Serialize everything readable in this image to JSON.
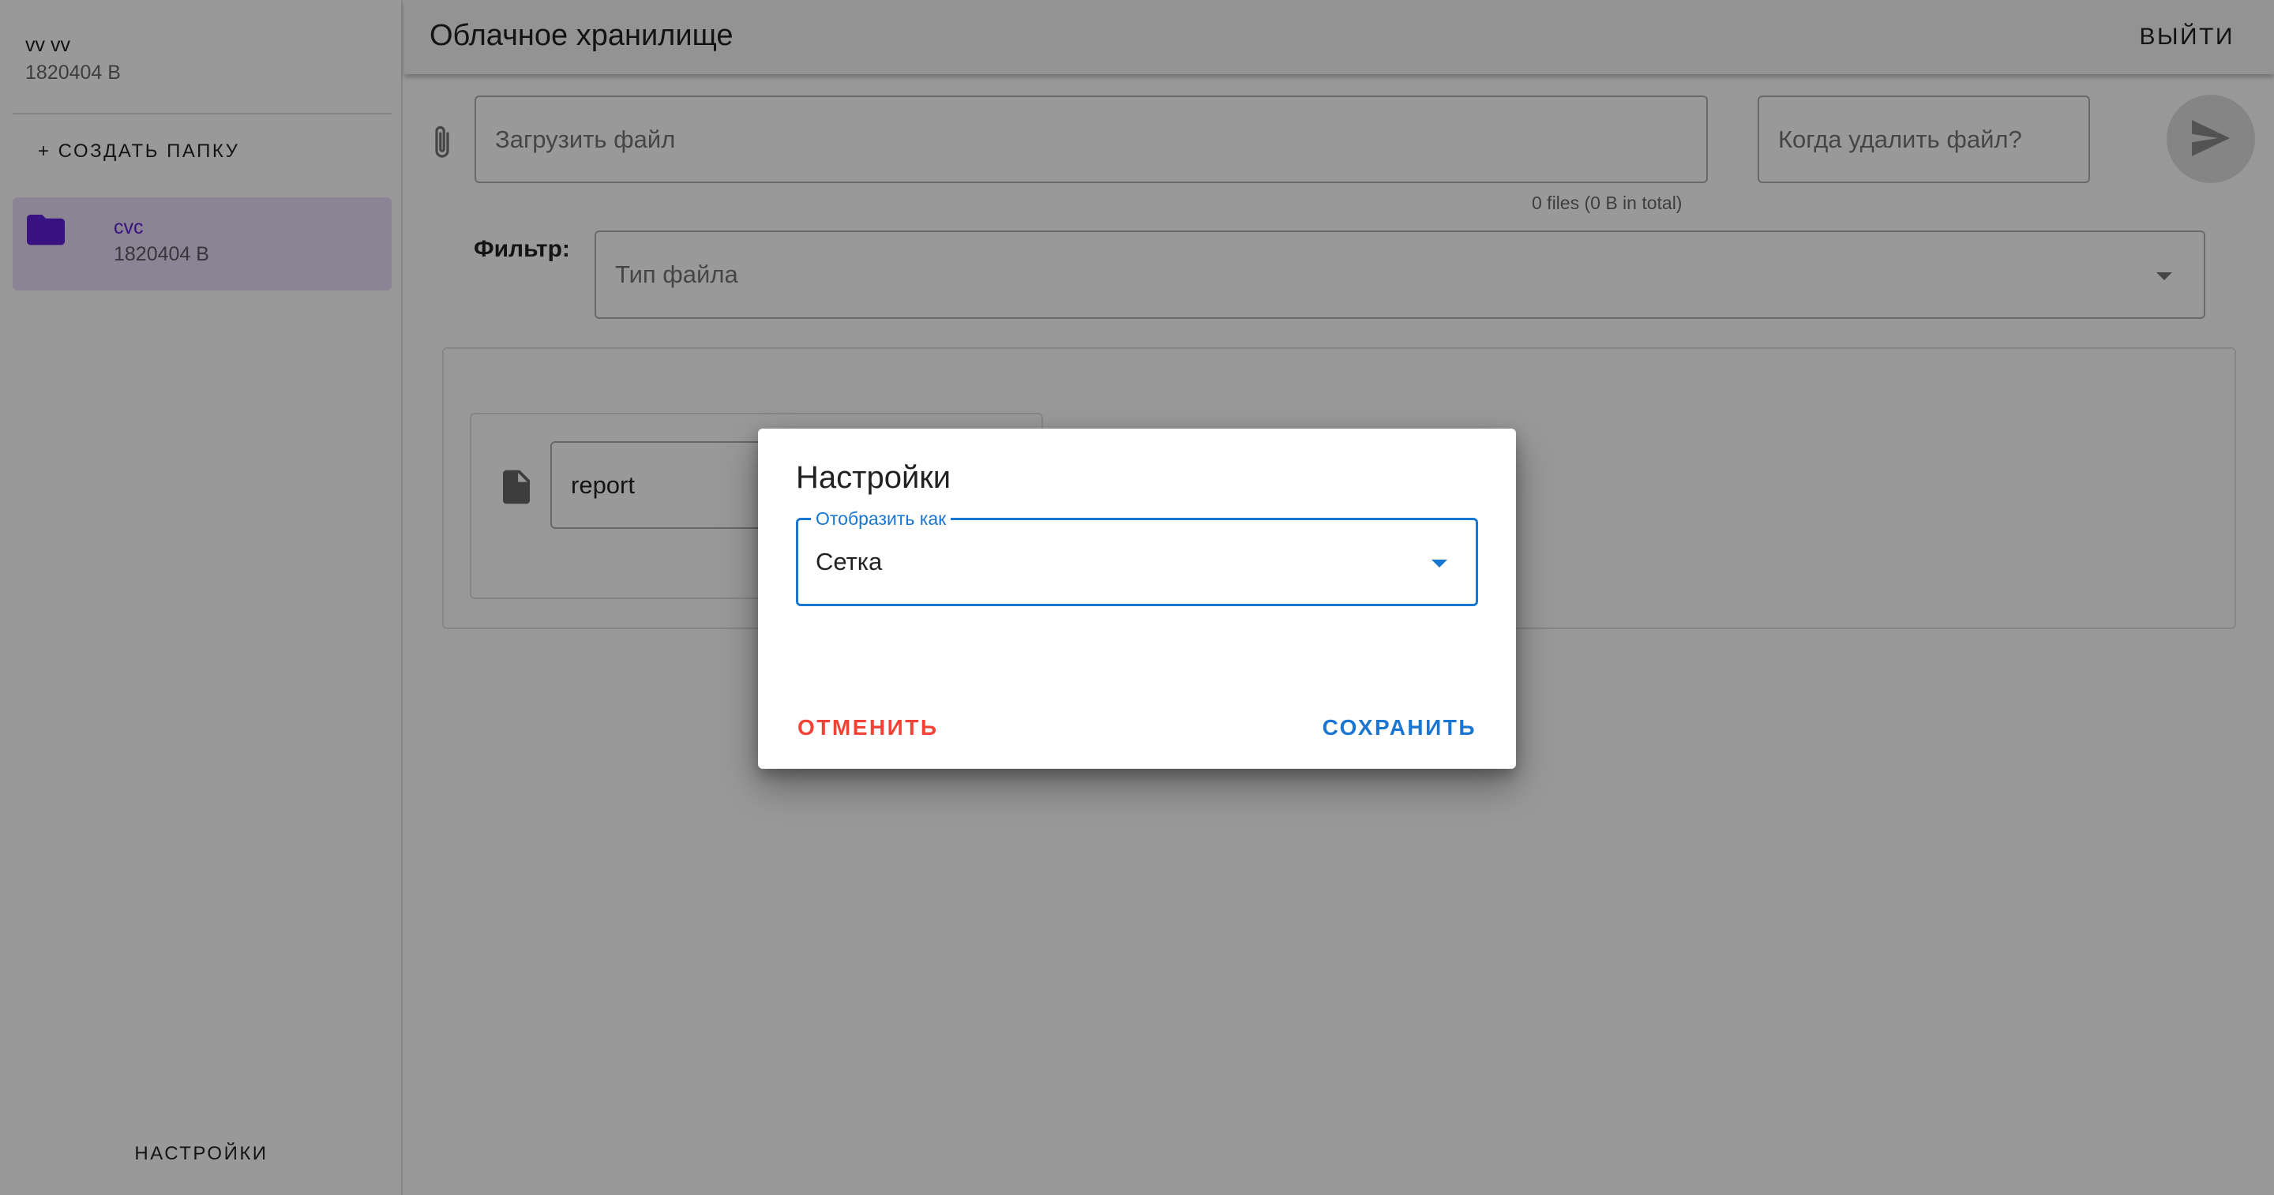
{
  "sidebar": {
    "user_name": "vv vv",
    "user_size": "1820404 B",
    "create_folder_label": "+ СОЗДАТЬ ПАПКУ",
    "folders": [
      {
        "name": "cvc",
        "size": "1820404 B",
        "icon": "folder-icon",
        "selected": true
      }
    ],
    "settings_label": "НАСТРОЙКИ"
  },
  "header": {
    "title": "Облачное хранилище",
    "logout_label": "ВЫЙТИ"
  },
  "upload": {
    "file_placeholder": "Загрузить файл",
    "delete_placeholder": "Когда удалить файл?",
    "files_info": "0 files (0 B in total)",
    "attach_icon": "paperclip-icon",
    "send_icon": "send-icon"
  },
  "filter": {
    "label": "Фильтр:",
    "placeholder": "Тип файла"
  },
  "files": [
    {
      "name": "report",
      "icon": "file-icon"
    }
  ],
  "dialog": {
    "title": "Настройки",
    "display_label": "Отобразить как",
    "display_value": "Сетка",
    "cancel_label": "ОТМЕНИТЬ",
    "save_label": "СОХРАНИТЬ"
  },
  "colors": {
    "primary": "#1976d2",
    "cancel": "#f44336",
    "folder_accent": "#5e1fd6",
    "folder_selected_bg": "#e8dcf8"
  }
}
